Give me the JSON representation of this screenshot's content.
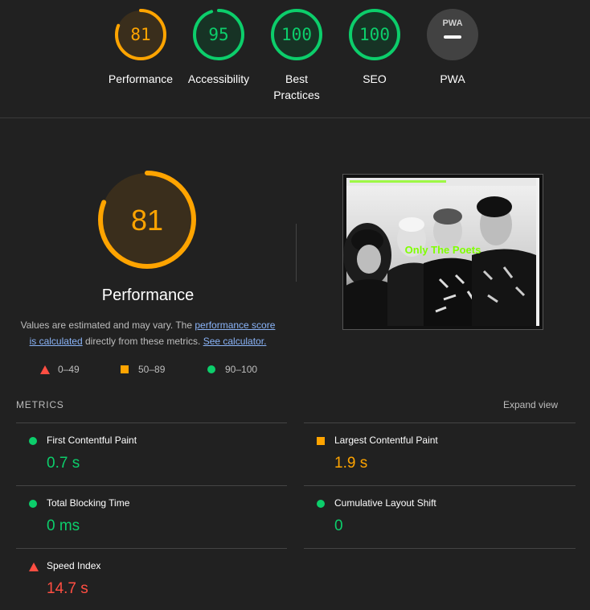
{
  "colors": {
    "pass": "#0cce6b",
    "average": "#ffa400",
    "fail": "#ff4e42",
    "na": "#9e9e9e"
  },
  "gauges": [
    {
      "score": "81",
      "label": "Performance",
      "level": "average",
      "fraction": 0.81
    },
    {
      "score": "95",
      "label": "Accessibility",
      "level": "pass",
      "fraction": 0.95
    },
    {
      "score": "100",
      "label_line1": "Best",
      "label_line2": "Practices",
      "level": "pass",
      "fraction": 1.0
    },
    {
      "score": "100",
      "label": "SEO",
      "level": "pass",
      "fraction": 1.0
    },
    {
      "badge": "PWA",
      "label": "PWA",
      "level": "na",
      "icon": "pwa-badge-icon"
    }
  ],
  "performance": {
    "score": "81",
    "fraction": 0.81,
    "title": "Performance",
    "desc_prefix": "Values are estimated and may vary. The ",
    "desc_link1": "performance score is calculated",
    "desc_middle": " directly from these metrics. ",
    "desc_link2": "See calculator.",
    "screenshot_text": "Only The Poets",
    "legend": [
      {
        "icon": "triangle-icon",
        "range": "0–49"
      },
      {
        "icon": "square-icon",
        "range": "50–89"
      },
      {
        "icon": "circle-icon",
        "range": "90–100"
      }
    ]
  },
  "metrics": {
    "heading": "METRICS",
    "expand_label": "Expand view",
    "items": [
      {
        "title": "First Contentful Paint",
        "value": "0.7 s",
        "level": "pass",
        "icon": "circle-icon"
      },
      {
        "title": "Largest Contentful Paint",
        "value": "1.9 s",
        "level": "average",
        "icon": "square-icon"
      },
      {
        "title": "Total Blocking Time",
        "value": "0 ms",
        "level": "pass",
        "icon": "circle-icon"
      },
      {
        "title": "Cumulative Layout Shift",
        "value": "0",
        "level": "pass",
        "icon": "circle-icon"
      },
      {
        "title": "Speed Index",
        "value": "14.7 s",
        "level": "fail",
        "icon": "triangle-icon"
      }
    ]
  }
}
